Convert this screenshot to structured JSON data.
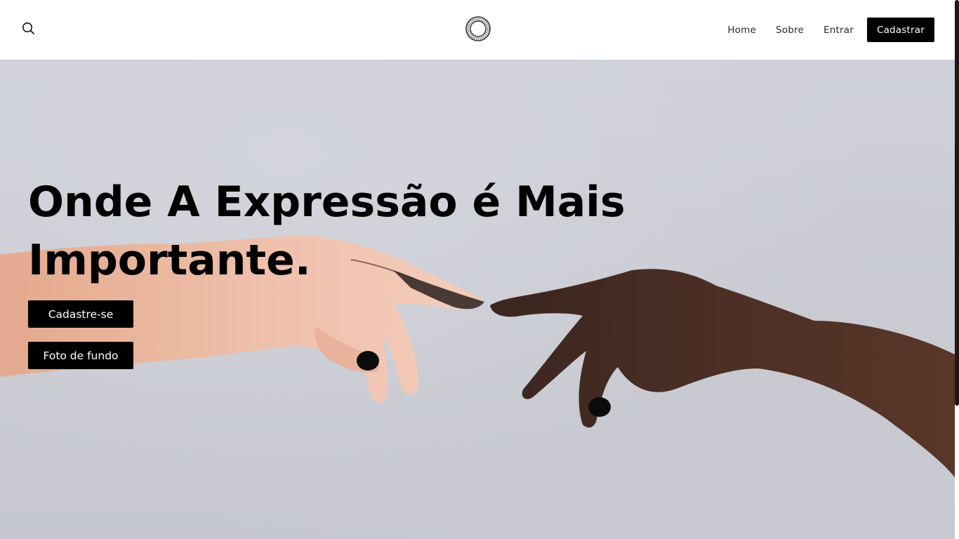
{
  "header": {
    "search_icon": "search-icon",
    "logo_icon": "ring-logo-icon",
    "nav": [
      {
        "label": "Home"
      },
      {
        "label": "Sobre"
      },
      {
        "label": "Entrar"
      }
    ],
    "cta_label": "Cadastrar"
  },
  "hero": {
    "title_line1": "Onde A Expressão é Mais",
    "title_line2": "Importante.",
    "signup_label": "Cadastre-se",
    "background_photo_label": "Foto de fundo"
  },
  "colors": {
    "header_bg": "#ffffff",
    "button_bg": "#000000",
    "button_text": "#ffffff",
    "hero_wall": "#cbccd4"
  }
}
